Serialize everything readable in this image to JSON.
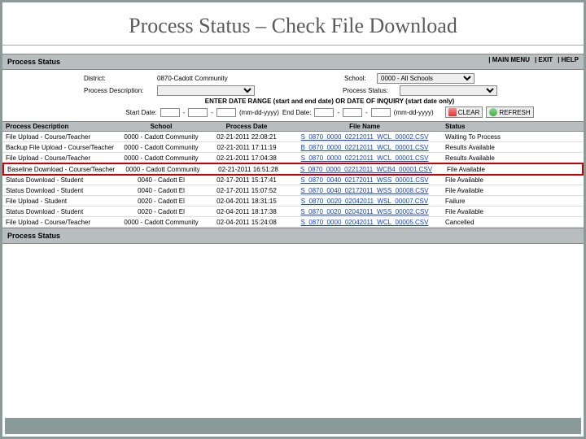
{
  "slide_title": "Process Status – Check File Download",
  "panel": {
    "heading": "Process Status",
    "links": {
      "main": "MAIN MENU",
      "exit": "EXIT",
      "help": "HELP"
    }
  },
  "filters": {
    "district_lbl": "District:",
    "district_val": "0870-Cadott Community",
    "school_lbl": "School:",
    "school_val": "0000 - All Schools",
    "pdesc_lbl": "Process Description:",
    "pstatus_lbl": "Process Status:",
    "range_note": "ENTER DATE RANGE (start and end date) OR DATE OF INQUIRY (start date only)",
    "start_lbl": "Start Date:",
    "end_lbl": "End Date:",
    "fmt": "(mm-dd-yyyy)",
    "clear": "CLEAR",
    "refresh": "REFRESH"
  },
  "cols": {
    "c1": "Process Description",
    "c2": "School",
    "c3": "Process Date",
    "c4": "File Name",
    "c5": "Status"
  },
  "rows": [
    {
      "d": "File Upload - Course/Teacher",
      "s": "0000 - Cadott Community",
      "p": "02-21-2011 22:08:21",
      "f": "S_0870_0000_02212011_WCL_00002.CSV",
      "st": "Waiting To Process",
      "hl": false
    },
    {
      "d": "Backup File Upload - Course/Teacher",
      "s": "0000 - Cadott Community",
      "p": "02-21-2011 17:11:19",
      "f": "B_0870_0000_02212011_WCL_00001.CSV",
      "st": "Results Available",
      "hl": false
    },
    {
      "d": "File Upload - Course/Teacher",
      "s": "0000 - Cadott Community",
      "p": "02-21-2011 17:04:38",
      "f": "S_0870_0000_02212011_WCL_00001.CSV",
      "st": "Results Available",
      "hl": false
    },
    {
      "d": "Baseline Download - Course/Teacher",
      "s": "0000 - Cadott Community",
      "p": "02-21-2011 16:51:28",
      "f": "S_0870_0000_02212011_WCB4_00001.CSV",
      "st": "File Available",
      "hl": true
    },
    {
      "d": "Status Download - Student",
      "s": "0040 - Cadott El",
      "p": "02-17-2011 15:17:41",
      "f": "S_0870_0040_02172011_WSS_00001.CSV",
      "st": "File Available",
      "hl": false
    },
    {
      "d": "Status Download - Student",
      "s": "0040 - Cadott El",
      "p": "02-17-2011 15:07:52",
      "f": "S_0870_0040_02172011_WSS_00008.CSV",
      "st": "File Available",
      "hl": false
    },
    {
      "d": "File Upload - Student",
      "s": "0020 - Cadott El",
      "p": "02-04-2011 18:31:15",
      "f": "S_0870_0020_02042011_WSL_00007.CSV",
      "st": "Failure",
      "hl": false
    },
    {
      "d": "Status Download - Student",
      "s": "0020 - Cadott El",
      "p": "02-04-2011 18:17:38",
      "f": "S_0870_0020_02042011_WSS_00002.CSV",
      "st": "File Available",
      "hl": false
    },
    {
      "d": "File Upload - Course/Teacher",
      "s": "0000 - Cadott Community",
      "p": "02-04-2011 15:24:08",
      "f": "S_0870_0000_02042011_WCL_00005.CSV",
      "st": "Cancelled",
      "hl": false
    }
  ],
  "footer_heading": "Process Status"
}
